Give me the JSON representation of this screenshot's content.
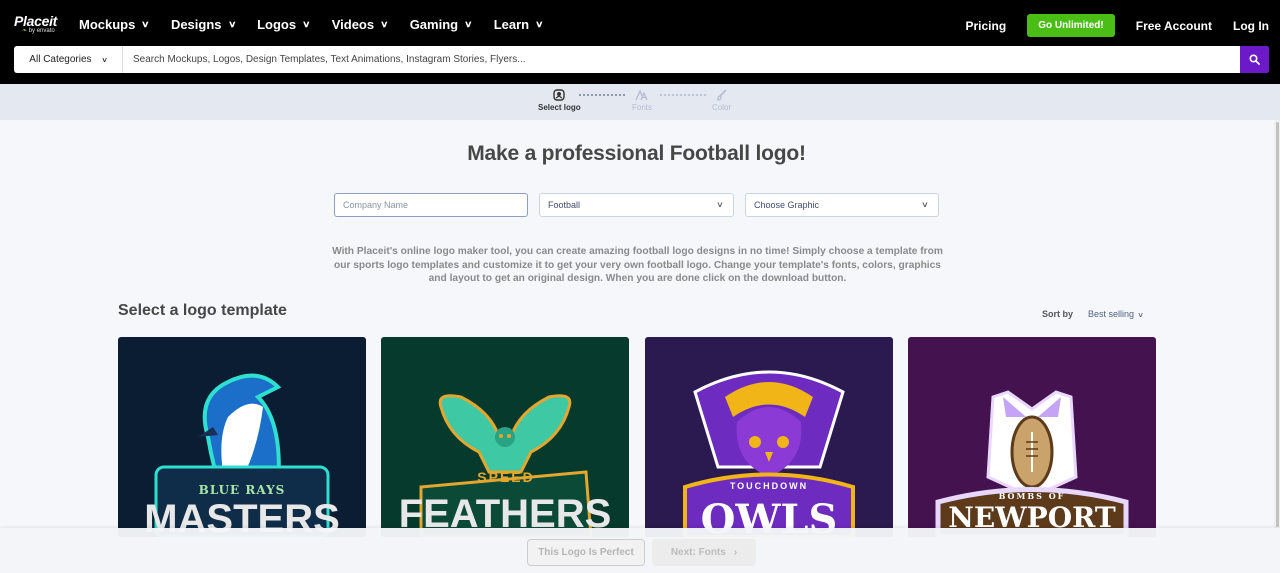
{
  "header": {
    "brand": "Placeit",
    "brand_sub": "by envato",
    "nav": [
      {
        "label": "Mockups"
      },
      {
        "label": "Designs"
      },
      {
        "label": "Logos"
      },
      {
        "label": "Videos"
      },
      {
        "label": "Gaming"
      },
      {
        "label": "Learn"
      }
    ],
    "pricing": "Pricing",
    "go_unlimited": "Go Unlimited!",
    "free_account": "Free Account",
    "login": "Log In",
    "category_select": "All Categories",
    "search_placeholder": "Search Mockups, Logos, Design Templates, Text Animations, Instagram Stories, Flyers...",
    "colors": {
      "go_unlimited_bg": "#4bbe16",
      "search_btn_bg": "#6b19c9"
    }
  },
  "stepper": {
    "steps": [
      {
        "label": "Select logo",
        "icon": "logo-icon",
        "state": "active"
      },
      {
        "label": "Fonts",
        "icon": "font-icon",
        "state": "inactive"
      },
      {
        "label": "Color",
        "icon": "brush-icon",
        "state": "inactive"
      }
    ]
  },
  "main": {
    "title": "Make a professional Football logo!",
    "company_name_placeholder": "Company Name",
    "industry_select": "Football",
    "graphic_select": "Choose Graphic",
    "description": "With Placeit's online logo maker tool, you can create amazing football logo designs in no time! Simply choose a template from our sports logo templates and customize it to get your very own football logo. Change your template's fonts, colors, graphics and layout to get an original design. When you are done click on the download button.",
    "section_title": "Select a logo template",
    "sort_label": "Sort by",
    "sort_value": "Best selling",
    "templates": [
      {
        "top_text": "BLUE RAYS",
        "main_text": "MASTERS",
        "bg": "#0b1d33",
        "mascot": "blue jay"
      },
      {
        "top_text": "SPEED",
        "main_text": "FEATHERS",
        "bg": "#063a2c",
        "mascot": "owl"
      },
      {
        "top_text": "TOUCHDOWN",
        "main_text": "OWLS",
        "bg": "#2a1a4f",
        "mascot": "purple owl"
      },
      {
        "top_text": "BOMBS OF",
        "main_text": "NEWPORT",
        "bg": "#44124f",
        "mascot": "football bomb"
      }
    ]
  },
  "footer": {
    "perfect_button": "This Logo Is Perfect",
    "next_button": "Next: Fonts"
  }
}
